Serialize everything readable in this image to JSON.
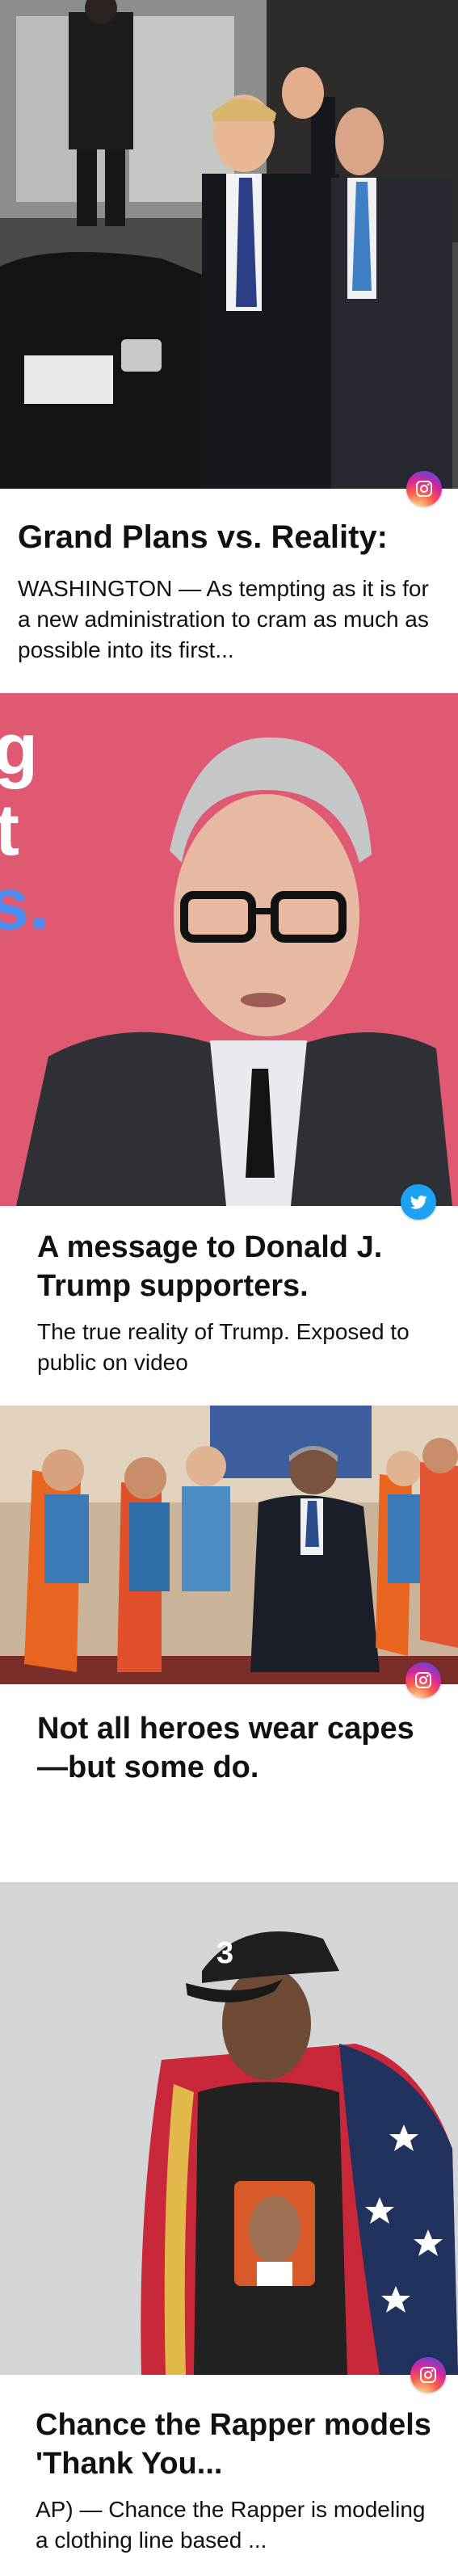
{
  "feed": {
    "items": [
      {
        "title": "Grand Plans vs. Reality:",
        "description": "WASHINGTON — As tempting as it is for a new administration to cram as much as possible into its first...",
        "source_icon": "instagram-icon",
        "image_alt": "man waving beside black car"
      },
      {
        "title": "A message to Donald J. Trump supporters.",
        "description": "The true reality of Trump. Exposed to public on video",
        "source_icon": "twitter-icon",
        "image_alt": "man in glasses speaking to camera",
        "overlay_chars": [
          "g",
          "t",
          "s."
        ]
      },
      {
        "title": "Not all heroes wear capes—but some do.",
        "description": "",
        "source_icon": "instagram-icon",
        "image_alt": "man kneeling with children in capes"
      },
      {
        "title": "Chance the Rapper models 'Thank You...",
        "description": "AP) — Chance the Rapper is modeling a clothing line based ...",
        "source_icon": "instagram-icon",
        "image_alt": "man in cap wrapped in flag",
        "hat_number": "3"
      }
    ]
  },
  "colors": {
    "instagram": "#d6249f",
    "twitter": "#1da1f2",
    "card2_bg": "#d9506a",
    "card2_accent": "#4a8cf0"
  }
}
